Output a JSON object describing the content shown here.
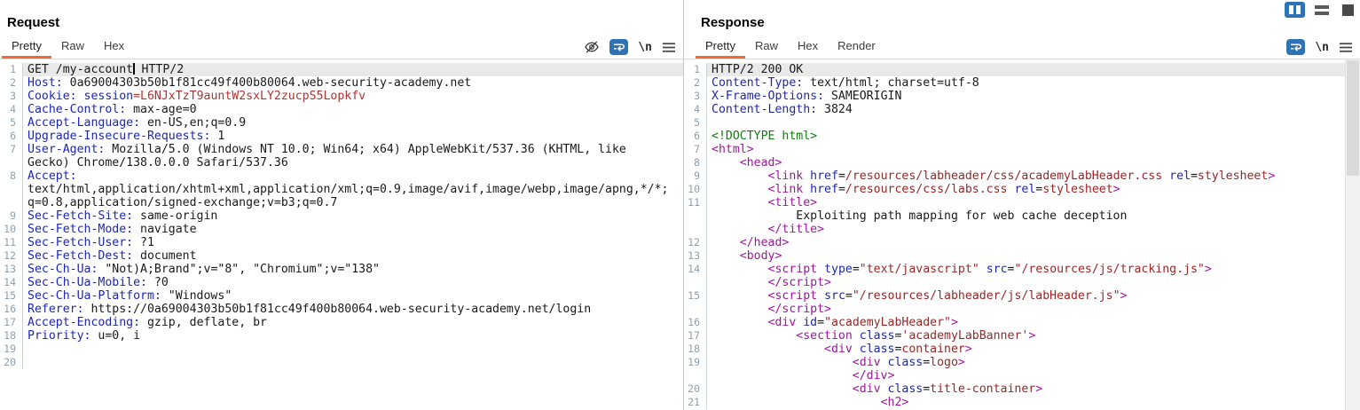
{
  "layout_toolbar": {
    "buttons": [
      {
        "name": "layout-columns-button",
        "active": true
      },
      {
        "name": "layout-rows-button",
        "active": false
      },
      {
        "name": "layout-single-button",
        "active": false
      }
    ]
  },
  "request": {
    "title": "Request",
    "tabs": [
      {
        "label": "Pretty",
        "active": true
      },
      {
        "label": "Raw",
        "active": false
      },
      {
        "label": "Hex",
        "active": false
      }
    ],
    "toolbar_icons": [
      {
        "name": "hide-nonprinting-icon",
        "glyph": "eye-slash"
      },
      {
        "name": "word-wrap-icon",
        "glyph": "wrap"
      },
      {
        "name": "newline-icon",
        "glyph": "newline",
        "text": "\\n"
      },
      {
        "name": "editor-menu-icon",
        "glyph": "menu"
      }
    ],
    "rows": [
      {
        "n": "1",
        "sel": true,
        "segs": [
          [
            "p",
            "GET /my-account"
          ],
          [
            "cursor",
            ""
          ],
          [
            "p",
            " HTTP/2"
          ]
        ]
      },
      {
        "n": "2",
        "segs": [
          [
            "h",
            "Host:"
          ],
          [
            "p",
            " 0a69004303b50b1f81cc49f400b80064.web-security-academy.net"
          ]
        ]
      },
      {
        "n": "3",
        "segs": [
          [
            "h",
            "Cookie:"
          ],
          [
            "p",
            " "
          ],
          [
            "h",
            "session"
          ],
          [
            "r",
            "=L6NJxTzT9auntW2sxLY2zucpS5Lopkfv"
          ]
        ]
      },
      {
        "n": "4",
        "segs": [
          [
            "h",
            "Cache-Control:"
          ],
          [
            "p",
            " max-age=0"
          ]
        ]
      },
      {
        "n": "5",
        "segs": [
          [
            "h",
            "Accept-Language:"
          ],
          [
            "p",
            " en-US,en;q=0.9"
          ]
        ]
      },
      {
        "n": "6",
        "segs": [
          [
            "h",
            "Upgrade-Insecure-Requests:"
          ],
          [
            "p",
            " 1"
          ]
        ]
      },
      {
        "n": "7",
        "segs": [
          [
            "h",
            "User-Agent:"
          ],
          [
            "p",
            " Mozilla/5.0 (Windows NT 10.0; Win64; x64) AppleWebKit/537.36 (KHTML, like"
          ]
        ]
      },
      {
        "segs": [
          [
            "p",
            "Gecko) Chrome/138.0.0.0 Safari/537.36"
          ]
        ]
      },
      {
        "n": "8",
        "segs": [
          [
            "h",
            "Accept:"
          ]
        ]
      },
      {
        "segs": [
          [
            "p",
            "text/html,application/xhtml+xml,application/xml;q=0.9,image/avif,image/webp,image/apng,*/*;"
          ]
        ]
      },
      {
        "segs": [
          [
            "p",
            "q=0.8,application/signed-exchange;v=b3;q=0.7"
          ]
        ]
      },
      {
        "n": "9",
        "segs": [
          [
            "h",
            "Sec-Fetch-Site:"
          ],
          [
            "p",
            " same-origin"
          ]
        ]
      },
      {
        "n": "10",
        "segs": [
          [
            "h",
            "Sec-Fetch-Mode:"
          ],
          [
            "p",
            " navigate"
          ]
        ]
      },
      {
        "n": "11",
        "segs": [
          [
            "h",
            "Sec-Fetch-User:"
          ],
          [
            "p",
            " ?1"
          ]
        ]
      },
      {
        "n": "12",
        "segs": [
          [
            "h",
            "Sec-Fetch-Dest:"
          ],
          [
            "p",
            " document"
          ]
        ]
      },
      {
        "n": "13",
        "segs": [
          [
            "h",
            "Sec-Ch-Ua:"
          ],
          [
            "p",
            " \"Not)A;Brand\";v=\"8\", \"Chromium\";v=\"138\""
          ]
        ]
      },
      {
        "n": "14",
        "segs": [
          [
            "h",
            "Sec-Ch-Ua-Mobile:"
          ],
          [
            "p",
            " ?0"
          ]
        ]
      },
      {
        "n": "15",
        "segs": [
          [
            "h",
            "Sec-Ch-Ua-Platform:"
          ],
          [
            "p",
            " \"Windows\""
          ]
        ]
      },
      {
        "n": "16",
        "segs": [
          [
            "h",
            "Referer:"
          ],
          [
            "p",
            " https://0a69004303b50b1f81cc49f400b80064.web-security-academy.net/login"
          ]
        ]
      },
      {
        "n": "17",
        "segs": [
          [
            "h",
            "Accept-Encoding:"
          ],
          [
            "p",
            " gzip, deflate, br"
          ]
        ]
      },
      {
        "n": "18",
        "segs": [
          [
            "h",
            "Priority:"
          ],
          [
            "p",
            " u=0, i"
          ]
        ]
      },
      {
        "n": "19",
        "segs": []
      },
      {
        "n": "20",
        "segs": []
      }
    ]
  },
  "response": {
    "title": "Response",
    "tabs": [
      {
        "label": "Pretty",
        "active": true
      },
      {
        "label": "Raw",
        "active": false
      },
      {
        "label": "Hex",
        "active": false
      },
      {
        "label": "Render",
        "active": false
      }
    ],
    "toolbar_icons": [
      {
        "name": "word-wrap-icon",
        "glyph": "wrap"
      },
      {
        "name": "newline-icon",
        "glyph": "newline",
        "text": "\\n"
      },
      {
        "name": "editor-menu-icon",
        "glyph": "menu"
      }
    ],
    "rows": [
      {
        "n": "1",
        "sel": true,
        "segs": [
          [
            "p",
            "HTTP/2 200 OK"
          ]
        ]
      },
      {
        "n": "2",
        "segs": [
          [
            "h",
            "Content-Type:"
          ],
          [
            "p",
            " text/html; charset=utf-8"
          ]
        ]
      },
      {
        "n": "3",
        "segs": [
          [
            "h",
            "X-Frame-Options:"
          ],
          [
            "p",
            " SAMEORIGIN"
          ]
        ]
      },
      {
        "n": "4",
        "segs": [
          [
            "h",
            "Content-Length:"
          ],
          [
            "p",
            " 3824"
          ]
        ]
      },
      {
        "n": "5",
        "segs": []
      },
      {
        "n": "6",
        "segs": [
          [
            "d",
            "<!DOCTYPE html>"
          ]
        ]
      },
      {
        "n": "7",
        "segs": [
          [
            "t",
            "<html>"
          ]
        ]
      },
      {
        "n": "8",
        "segs": [
          [
            "p",
            "    "
          ],
          [
            "t",
            "<head>"
          ]
        ]
      },
      {
        "n": "9",
        "segs": [
          [
            "p",
            "        "
          ],
          [
            "t",
            "<link "
          ],
          [
            "a",
            "href"
          ],
          [
            "p",
            "="
          ],
          [
            "v",
            "/resources/labheader/css/academyLabHeader.css"
          ],
          [
            "p",
            " "
          ],
          [
            "a",
            "rel"
          ],
          [
            "p",
            "="
          ],
          [
            "v",
            "stylesheet"
          ],
          [
            "t",
            ">"
          ]
        ]
      },
      {
        "n": "10",
        "segs": [
          [
            "p",
            "        "
          ],
          [
            "t",
            "<link "
          ],
          [
            "a",
            "href"
          ],
          [
            "p",
            "="
          ],
          [
            "v",
            "/resources/css/labs.css"
          ],
          [
            "p",
            " "
          ],
          [
            "a",
            "rel"
          ],
          [
            "p",
            "="
          ],
          [
            "v",
            "stylesheet"
          ],
          [
            "t",
            ">"
          ]
        ]
      },
      {
        "n": "11",
        "segs": [
          [
            "p",
            "        "
          ],
          [
            "t",
            "<title>"
          ]
        ]
      },
      {
        "segs": [
          [
            "p",
            "            Exploiting path mapping for web cache deception"
          ]
        ]
      },
      {
        "segs": [
          [
            "p",
            "        "
          ],
          [
            "t",
            "</title>"
          ]
        ]
      },
      {
        "n": "12",
        "segs": [
          [
            "p",
            "    "
          ],
          [
            "t",
            "</head>"
          ]
        ]
      },
      {
        "n": "13",
        "segs": [
          [
            "p",
            "    "
          ],
          [
            "t",
            "<body>"
          ]
        ]
      },
      {
        "n": "14",
        "segs": [
          [
            "p",
            "        "
          ],
          [
            "t",
            "<script "
          ],
          [
            "a",
            "type"
          ],
          [
            "p",
            "="
          ],
          [
            "v",
            "\"text/javascript\""
          ],
          [
            "p",
            " "
          ],
          [
            "a",
            "src"
          ],
          [
            "p",
            "="
          ],
          [
            "v",
            "\"/resources/js/tracking.js\""
          ],
          [
            "t",
            ">"
          ]
        ]
      },
      {
        "segs": [
          [
            "p",
            "        "
          ],
          [
            "t",
            "</script>"
          ]
        ]
      },
      {
        "n": "15",
        "segs": [
          [
            "p",
            "        "
          ],
          [
            "t",
            "<script "
          ],
          [
            "a",
            "src"
          ],
          [
            "p",
            "="
          ],
          [
            "v",
            "\"/resources/labheader/js/labHeader.js\""
          ],
          [
            "t",
            ">"
          ]
        ]
      },
      {
        "segs": [
          [
            "p",
            "        "
          ],
          [
            "t",
            "</script>"
          ]
        ]
      },
      {
        "n": "16",
        "segs": [
          [
            "p",
            "        "
          ],
          [
            "t",
            "<div "
          ],
          [
            "a",
            "id"
          ],
          [
            "p",
            "="
          ],
          [
            "v",
            "\"academyLabHeader\""
          ],
          [
            "t",
            ">"
          ]
        ]
      },
      {
        "n": "17",
        "segs": [
          [
            "p",
            "            "
          ],
          [
            "t",
            "<section "
          ],
          [
            "a",
            "class"
          ],
          [
            "p",
            "="
          ],
          [
            "v",
            "'academyLabBanner'"
          ],
          [
            "t",
            ">"
          ]
        ]
      },
      {
        "n": "18",
        "segs": [
          [
            "p",
            "                "
          ],
          [
            "t",
            "<div "
          ],
          [
            "a",
            "class"
          ],
          [
            "p",
            "="
          ],
          [
            "v",
            "container"
          ],
          [
            "t",
            ">"
          ]
        ]
      },
      {
        "n": "19",
        "segs": [
          [
            "p",
            "                    "
          ],
          [
            "t",
            "<div "
          ],
          [
            "a",
            "class"
          ],
          [
            "p",
            "="
          ],
          [
            "v",
            "logo"
          ],
          [
            "t",
            ">"
          ]
        ]
      },
      {
        "segs": [
          [
            "p",
            "                    "
          ],
          [
            "t",
            "</div>"
          ]
        ]
      },
      {
        "n": "20",
        "segs": [
          [
            "p",
            "                    "
          ],
          [
            "t",
            "<div "
          ],
          [
            "a",
            "class"
          ],
          [
            "p",
            "="
          ],
          [
            "v",
            "title-container"
          ],
          [
            "t",
            ">"
          ]
        ]
      },
      {
        "n": "21",
        "segs": [
          [
            "p",
            "                        "
          ],
          [
            "t",
            "<h2>"
          ]
        ]
      }
    ]
  },
  "colors": {
    "accent_orange": "#f26b33",
    "icon_blue": "#2e74b5",
    "header_name_blue": "#1d28ad",
    "value_red": "#b03232",
    "attr_value_red": "#9a2626",
    "tag_purple": "#a015a0",
    "doctype_green": "#0e7d0e",
    "selected_row_bg": "#e9e9e9",
    "line_number_gray": "#8e9fae"
  }
}
